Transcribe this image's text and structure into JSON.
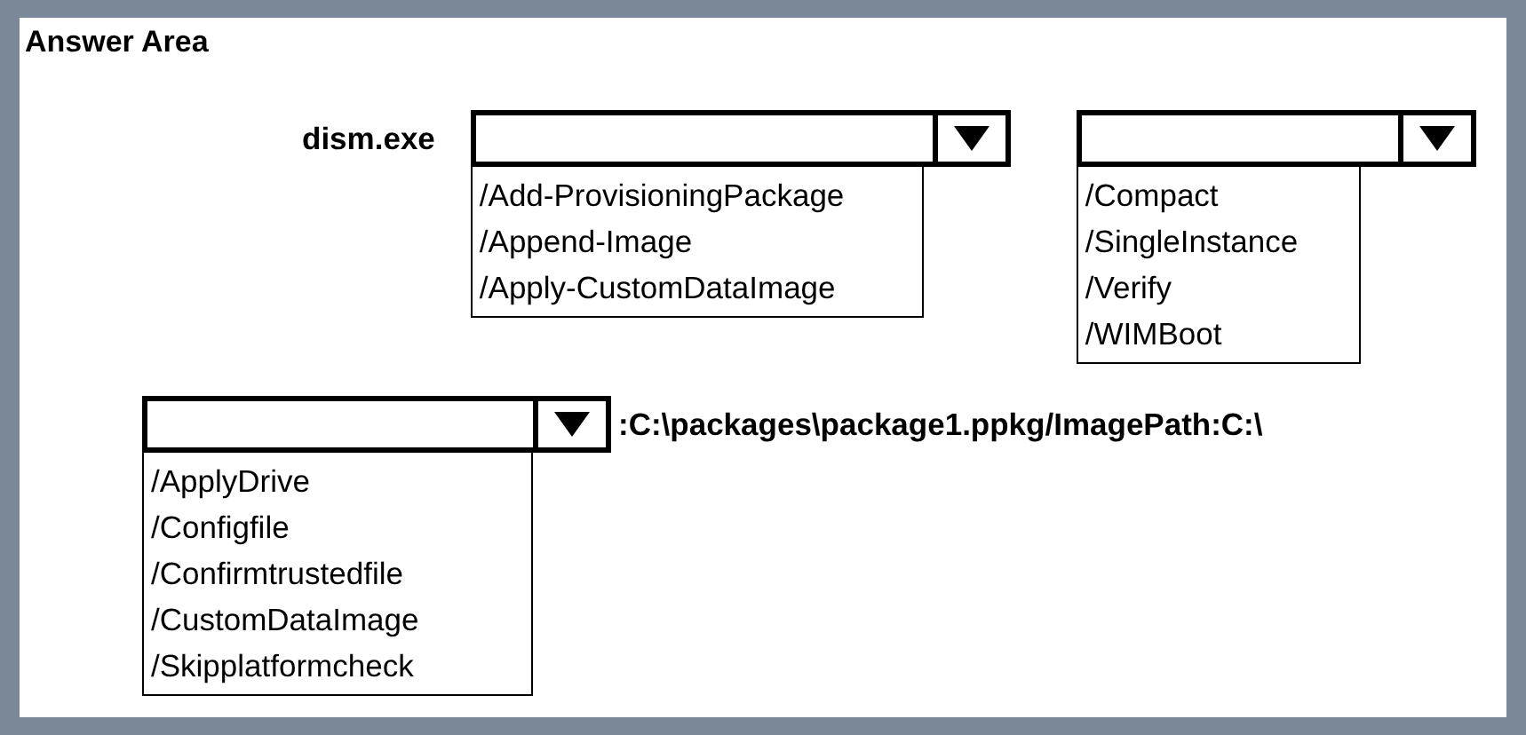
{
  "title": "Answer Area",
  "rows": [
    {
      "items": [
        {
          "kind": "label",
          "text": "dism.exe"
        },
        {
          "kind": "dropdown",
          "options": [
            "/Add-ProvisioningPackage",
            "/Append-Image",
            "/Apply-CustomDataImage"
          ]
        },
        {
          "kind": "dropdown",
          "options": [
            "/Compact",
            "/SingleInstance",
            "/Verify",
            "/WIMBoot"
          ]
        }
      ]
    },
    {
      "items": [
        {
          "kind": "dropdown",
          "options": [
            "/ApplyDrive",
            "/Configfile",
            "/Confirmtrustedfile",
            "/CustomDataImage",
            "/Skipplatformcheck"
          ]
        },
        {
          "kind": "label",
          "text": ":C:\\packages\\package1.ppkg/ImagePath:C:\\"
        }
      ]
    }
  ]
}
